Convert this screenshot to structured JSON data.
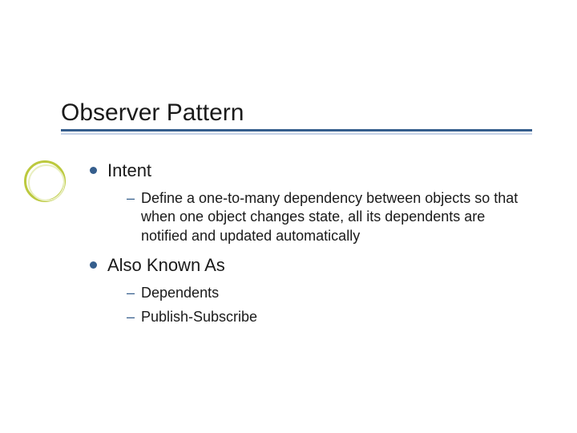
{
  "title": "Observer Pattern",
  "sections": [
    {
      "heading": "Intent",
      "items": [
        "Define a one-to-many dependency between objects so that when one object changes state, all its dependents are notified and updated automatically"
      ]
    },
    {
      "heading": "Also Known As",
      "items": [
        "Dependents",
        "Publish-Subscribe"
      ]
    }
  ]
}
